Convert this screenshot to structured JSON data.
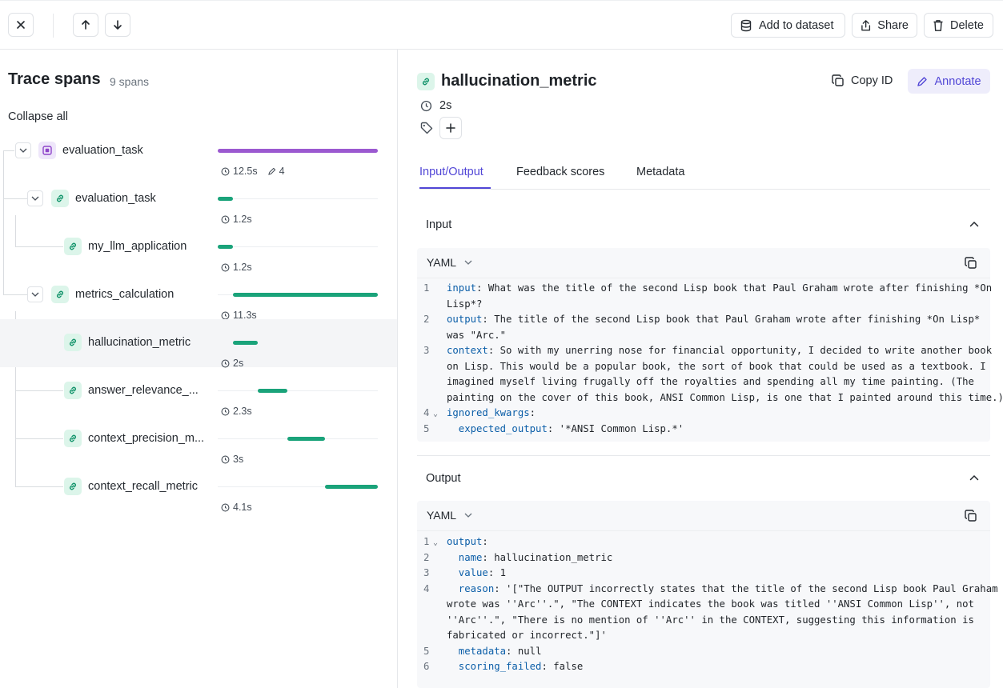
{
  "topbar": {
    "add_to_dataset": "Add to dataset",
    "share": "Share",
    "delete": "Delete"
  },
  "left": {
    "title": "Trace spans",
    "count": "9 spans",
    "collapse_all": "Collapse all",
    "spans": [
      {
        "name": "evaluation_task",
        "duration": "12.5s",
        "annotations": "4",
        "color": "#9b59d0"
      },
      {
        "name": "evaluation_task",
        "duration": "1.2s",
        "color": "#1aa37a"
      },
      {
        "name": "my_llm_application",
        "duration": "1.2s",
        "color": "#1aa37a"
      },
      {
        "name": "metrics_calculation",
        "duration": "11.3s",
        "color": "#1aa37a"
      },
      {
        "name": "hallucination_metric",
        "duration": "2s",
        "color": "#1aa37a"
      },
      {
        "name": "answer_relevance_...",
        "duration": "2.3s",
        "color": "#1aa37a"
      },
      {
        "name": "context_precision_m...",
        "duration": "3s",
        "color": "#1aa37a"
      },
      {
        "name": "context_recall_metric",
        "duration": "4.1s",
        "color": "#1aa37a"
      }
    ]
  },
  "detail": {
    "title": "hallucination_metric",
    "duration": "2s",
    "copy_id": "Copy ID",
    "annotate": "Annotate",
    "tabs": [
      "Input/Output",
      "Feedback scores",
      "Metadata"
    ],
    "input": {
      "title": "Input",
      "format": "YAML",
      "lines": [
        {
          "n": "1",
          "key": "input",
          "rest": ": What was the title of the second Lisp book that Paul Graham wrote after finishing *On"
        },
        {
          "n": "",
          "key": "",
          "rest": "Lisp*?"
        },
        {
          "n": "2",
          "key": "output",
          "rest": ": The title of the second Lisp book that Paul Graham wrote after finishing *On Lisp*"
        },
        {
          "n": "",
          "key": "",
          "rest": "was \"Arc.\""
        },
        {
          "n": "3",
          "key": "context",
          "rest": ": So with my unerring nose for financial opportunity, I decided to write another book"
        },
        {
          "n": "",
          "key": "",
          "rest": "on Lisp. This would be a popular book, the sort of book that could be used as a textbook. I"
        },
        {
          "n": "",
          "key": "",
          "rest": "imagined myself living frugally off the royalties and spending all my time painting. (The"
        },
        {
          "n": "",
          "key": "",
          "rest": "painting on the cover of this book, ANSI Common Lisp, is one that I painted around this time.)"
        },
        {
          "n": "4",
          "key": "ignored_kwargs",
          "rest": ":",
          "fold": true
        },
        {
          "n": "5",
          "key": "  expected_output",
          "rest": ": '*ANSI Common Lisp.*'"
        }
      ]
    },
    "output": {
      "title": "Output",
      "format": "YAML",
      "lines": [
        {
          "n": "1",
          "key": "output",
          "rest": ":",
          "fold": true
        },
        {
          "n": "2",
          "key": "  name",
          "rest": ": hallucination_metric"
        },
        {
          "n": "3",
          "key": "  value",
          "rest": ": 1"
        },
        {
          "n": "4",
          "key": "  reason",
          "rest": ": '[\"The OUTPUT incorrectly states that the title of the second Lisp book Paul Graham"
        },
        {
          "n": "",
          "key": "",
          "rest": "wrote was ''Arc''.\", \"The CONTEXT indicates the book was titled ''ANSI Common Lisp'', not"
        },
        {
          "n": "",
          "key": "",
          "rest": "''Arc''.\", \"There is no mention of ''Arc'' in the CONTEXT, suggesting this information is"
        },
        {
          "n": "",
          "key": "",
          "rest": "fabricated or incorrect.\"]'"
        },
        {
          "n": "5",
          "key": "  metadata",
          "rest": ": null"
        },
        {
          "n": "6",
          "key": "  scoring_failed",
          "rest": ": false"
        }
      ]
    }
  }
}
